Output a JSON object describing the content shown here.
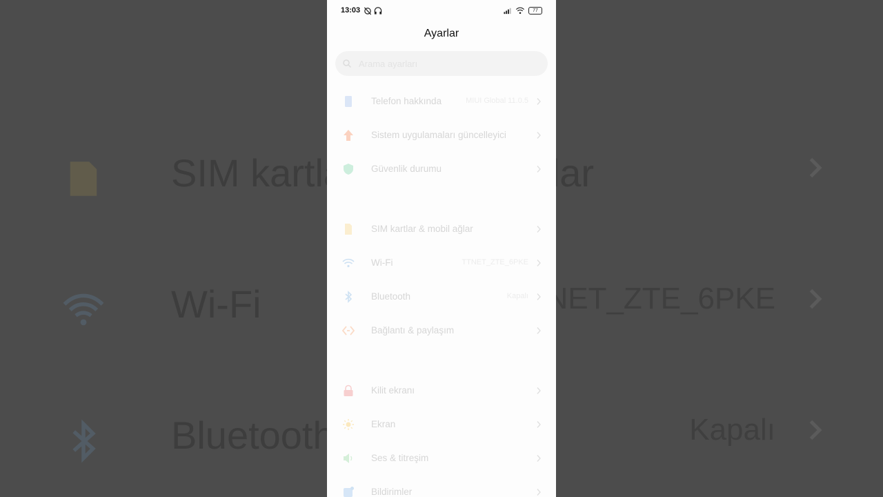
{
  "status_bar": {
    "time": "13:03",
    "battery": "77"
  },
  "header": {
    "title": "Ayarlar"
  },
  "search": {
    "placeholder": "Arama ayarları"
  },
  "items": [
    {
      "label": "Telefon hakkında",
      "value": "MIUI Global 11.0.5"
    },
    {
      "label": "Sistem uygulamaları güncelleyici",
      "value": ""
    },
    {
      "label": "Güvenlik durumu",
      "value": ""
    },
    {
      "label": "SIM kartlar & mobil ağlar",
      "value": ""
    },
    {
      "label": "Wi-Fi",
      "value": "TTNET_ZTE_6PKE"
    },
    {
      "label": "Bluetooth",
      "value": "Kapalı"
    },
    {
      "label": "Bağlantı & paylaşım",
      "value": ""
    },
    {
      "label": "Kilit ekranı",
      "value": ""
    },
    {
      "label": "Ekran",
      "value": ""
    },
    {
      "label": "Ses & titreşim",
      "value": ""
    },
    {
      "label": "Bildirimler",
      "value": ""
    }
  ],
  "background": {
    "rows": [
      {
        "label": "SIM kartlar & mobil ağlar",
        "value": ""
      },
      {
        "label": "Wi-Fi",
        "value": "TTNET_ZTE_6PKE"
      },
      {
        "label": "Bluetooth",
        "value": "Kapalı"
      }
    ]
  },
  "colors": {
    "screen_bg": "#fdfdfd",
    "backdrop": "#4c4c4c",
    "faded_text": "#d6d6d6"
  }
}
